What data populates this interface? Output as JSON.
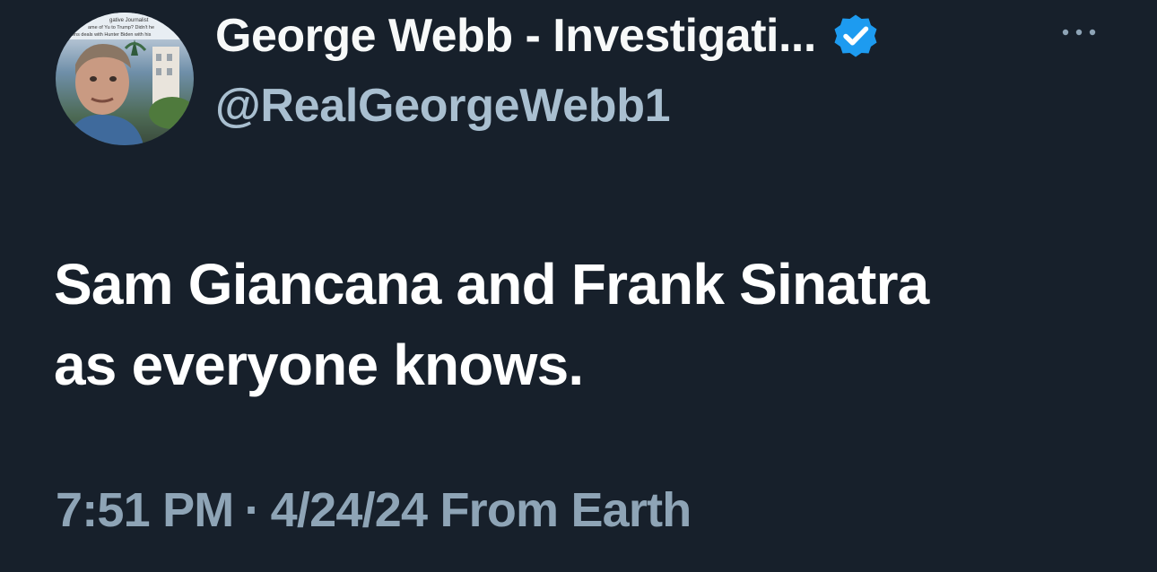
{
  "author": {
    "display_name": "George Webb - Investigati...",
    "handle": "@RealGeorgeWebb1",
    "verified": true,
    "avatar_caption_lines": [
      "gative Journalist",
      "ame of Yu to Trump? Didn't he",
      "ons deals with Hunter Biden with his"
    ]
  },
  "tweet": {
    "text_lines": [
      "Sam Giancana and Frank Sinatra",
      "as everyone knows."
    ]
  },
  "meta": {
    "time": "7:51 PM",
    "separator": "·",
    "date": "4/24/24",
    "location": "From Earth"
  },
  "colors": {
    "background": "#17202b",
    "text": "#f7f9f9",
    "handle": "#a9bfd0",
    "meta": "#8ea4b6",
    "verified": "#1d9bf0"
  },
  "icons": {
    "verified": "verified-badge-icon",
    "more": "more-options-icon"
  }
}
